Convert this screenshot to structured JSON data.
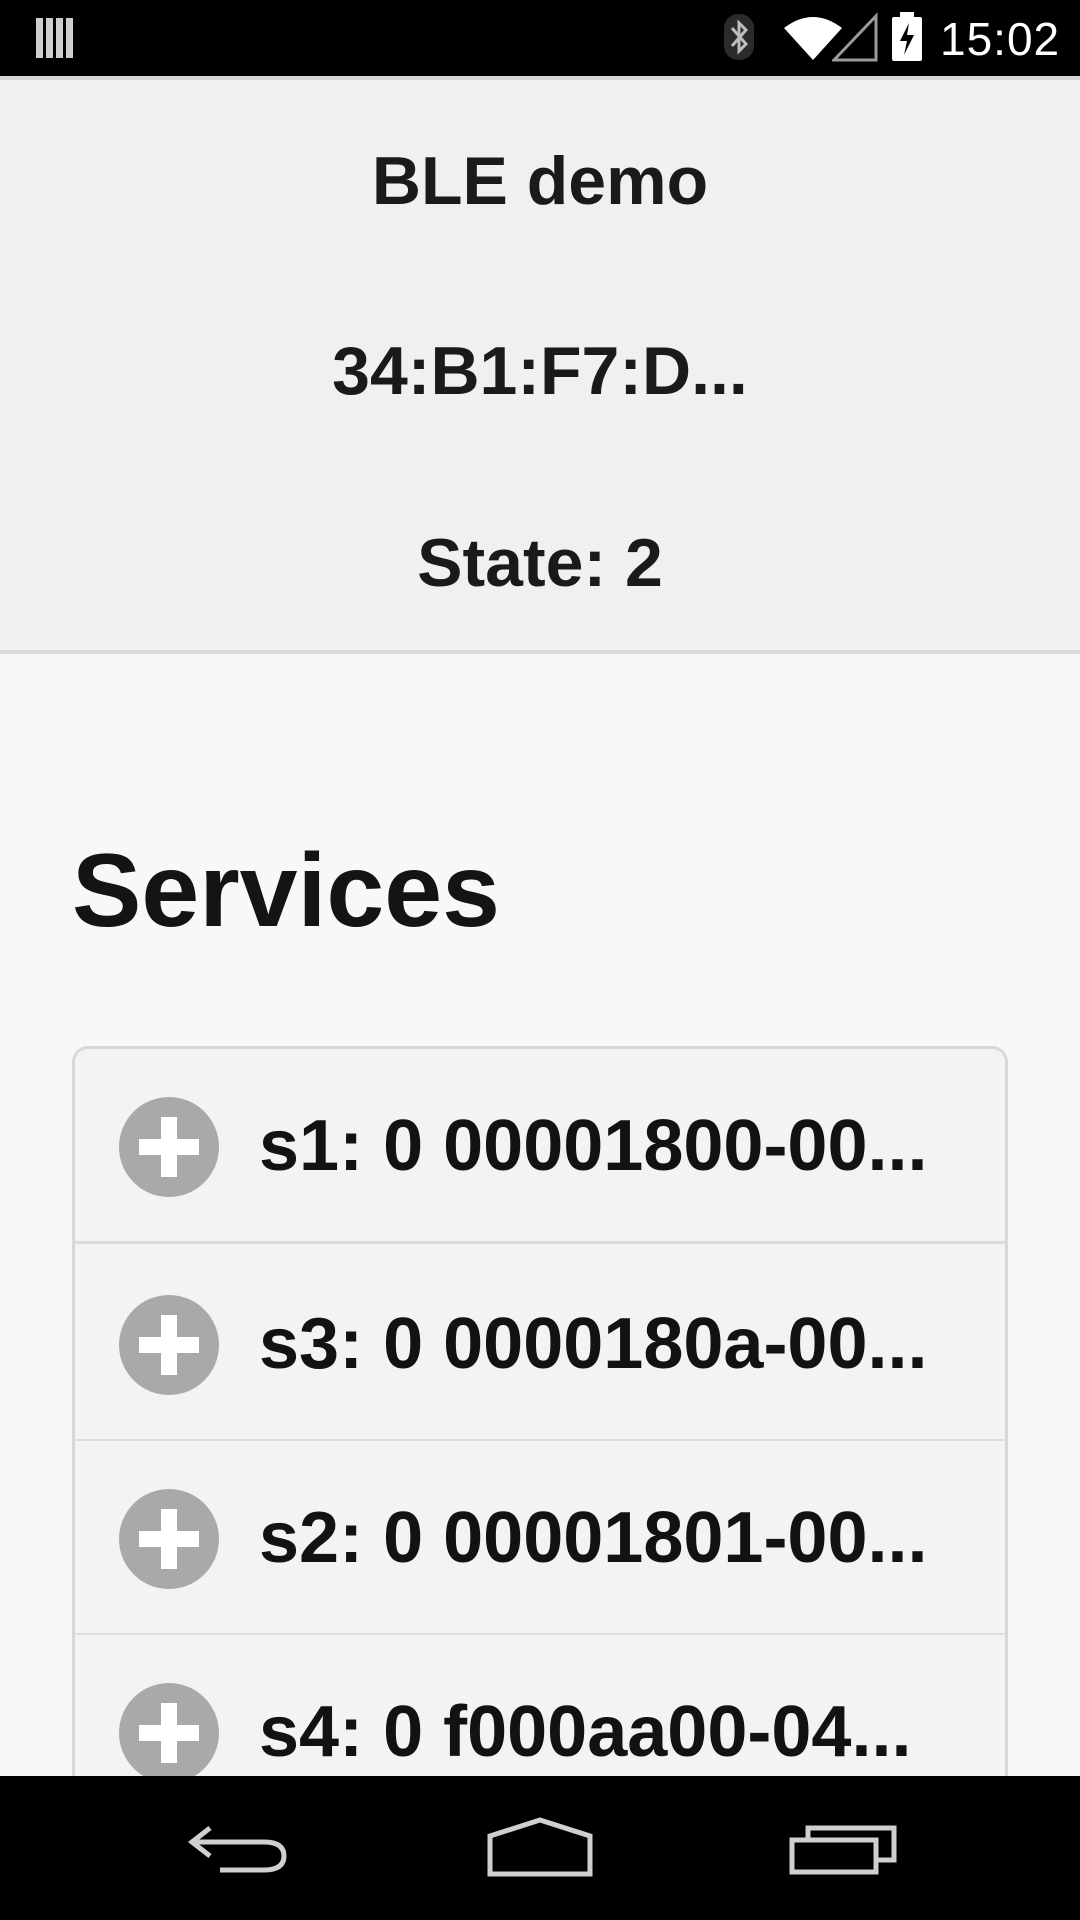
{
  "status_bar": {
    "time": "15:02",
    "icons": [
      "sim-card-icon",
      "bluetooth-icon",
      "wifi-icon",
      "cell-signal-icon",
      "battery-charging-icon"
    ]
  },
  "header": {
    "title": "BLE demo",
    "address": "34:B1:F7:D...",
    "state": "State: 2"
  },
  "services": {
    "heading": "Services",
    "items": [
      {
        "label": "s1: 0 00001800-00..."
      },
      {
        "label": "s3: 0 0000180a-00..."
      },
      {
        "label": "s2: 0 00001801-00..."
      },
      {
        "label": "s4: 0 f000aa00-04..."
      }
    ]
  },
  "nav_bar": {
    "icons": [
      "back-icon",
      "home-icon",
      "recents-icon"
    ]
  },
  "colors": {
    "status_bar": "#000000",
    "header_bg": "#f0f0f0",
    "page_bg": "#f8f8f8",
    "plus_icon": "#a9a9a9"
  }
}
